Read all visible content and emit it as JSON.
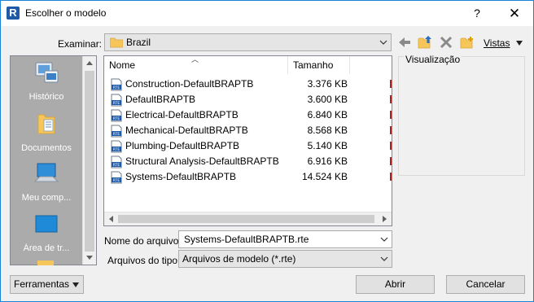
{
  "titlebar": {
    "title": "Escolher o modelo",
    "app_icon_letter": "R",
    "help_label": "?",
    "close_label": "✕"
  },
  "toolbar": {
    "look_in_label": "Examinar:",
    "look_in_value": "Brazil",
    "views_label": "Vistas",
    "icons": [
      "back-arrow-icon",
      "up-folder-icon",
      "delete-icon",
      "new-folder-icon",
      "views-dropdown-icon"
    ]
  },
  "places": [
    {
      "label": "Histórico",
      "icon": "history-icon"
    },
    {
      "label": "Documentos",
      "icon": "documents-icon"
    },
    {
      "label": "Meu comp...",
      "icon": "computer-icon"
    },
    {
      "label": "Área de tr...",
      "icon": "desktop-icon"
    }
  ],
  "filelist": {
    "columns": [
      "Nome",
      "Tamanho"
    ],
    "rows": [
      {
        "name": "Construction-DefaultBRAPTB",
        "size": "3.376 KB",
        "icon": "rte-file-icon"
      },
      {
        "name": "DefaultBRAPTB",
        "size": "3.600 KB",
        "icon": "rte-file-icon"
      },
      {
        "name": "Electrical-DefaultBRAPTB",
        "size": "6.840 KB",
        "icon": "rte-file-icon"
      },
      {
        "name": "Mechanical-DefaultBRAPTB",
        "size": "8.568 KB",
        "icon": "rte-file-icon"
      },
      {
        "name": "Plumbing-DefaultBRAPTB",
        "size": "5.140 KB",
        "icon": "rte-file-icon"
      },
      {
        "name": "Structural Analysis-DefaultBRAPTB",
        "size": "6.916 KB",
        "icon": "rte-file-icon"
      },
      {
        "name": "Systems-DefaultBRAPTB",
        "size": "14.524 KB",
        "icon": "rte-file-icon"
      }
    ]
  },
  "preview": {
    "label": "Visualização"
  },
  "form": {
    "filename_label": "Nome do arquivo:",
    "filename_value": "Systems-DefaultBRAPTB.rte",
    "filetype_label": "Arquivos do tipo:",
    "filetype_value": "Arquivos de modelo  (*.rte)"
  },
  "buttons": {
    "tools": "Ferramentas",
    "open": "Abrir",
    "cancel": "Cancelar"
  },
  "colors": {
    "accent": "#1883d7",
    "places_bg": "#ababab",
    "rte_icon": "#1e5aa8"
  }
}
